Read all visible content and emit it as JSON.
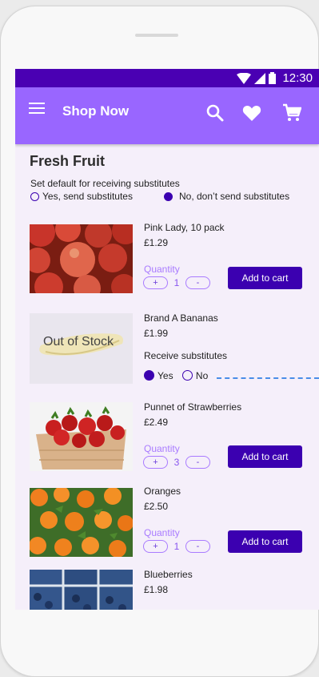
{
  "status": {
    "time": "12:30"
  },
  "appbar": {
    "title": "Shop Now"
  },
  "section": {
    "title": "Fresh Fruit",
    "subs_label": "Set default for receiving substitutes",
    "subs_yes": "Yes, send substitutes",
    "subs_no": "No, don’t send substitutes"
  },
  "colors": {
    "primary": "#9966ff",
    "dark": "#4a00b3",
    "button": "#3b00b0",
    "accent_dash": "#4a8de8"
  },
  "products": [
    {
      "name": "Pink Lady, 10 pack",
      "price": "£1.29",
      "qty_label": "Quantity",
      "plus": "+",
      "minus": "-",
      "qty": "1",
      "cart": "Add to cart"
    },
    {
      "name": "Brand A Bananas",
      "price": "£1.99",
      "oos": "Out of  Stock",
      "subs_label": "Receive substitutes",
      "yes": "Yes",
      "no": "No"
    },
    {
      "name": "Punnet of Strawberries",
      "price": "£2.49",
      "qty_label": "Quantity",
      "plus": "+",
      "minus": "-",
      "qty": "3",
      "cart": "Add to cart"
    },
    {
      "name": "Oranges",
      "price": "£2.50",
      "qty_label": "Quantity",
      "plus": "+",
      "minus": "-",
      "qty": "1",
      "cart": "Add to cart"
    },
    {
      "name": "Blueberries",
      "price": "£1.98"
    }
  ]
}
